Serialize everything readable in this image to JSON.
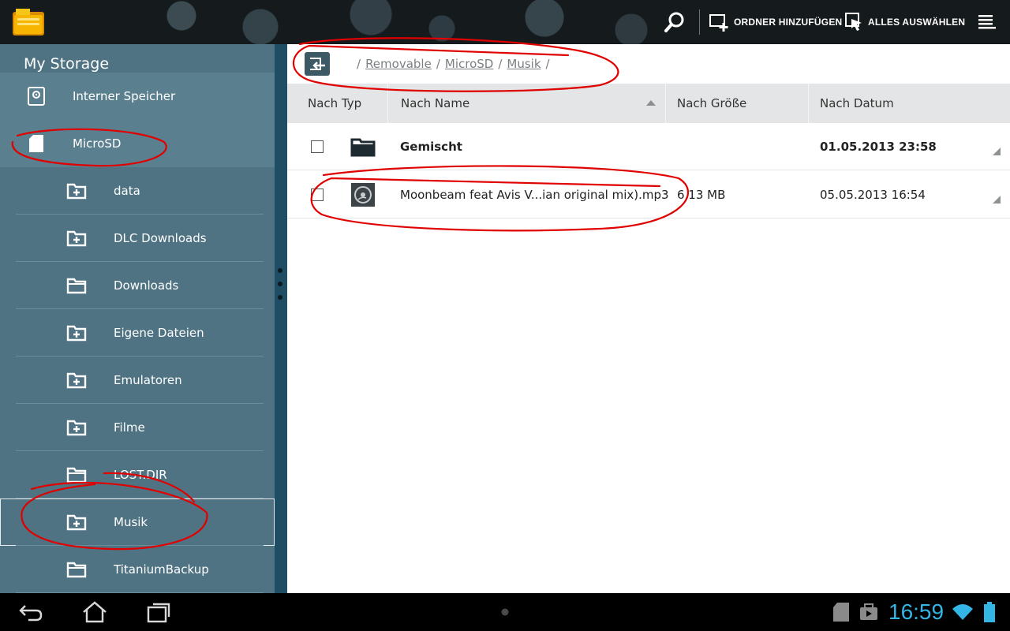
{
  "actionbar": {
    "search_label": "search",
    "add_folder_label": "ORDNER HINZUFÜGEN",
    "select_all_label": "ALLES AUSWÄHLEN"
  },
  "sidebar": {
    "title": "My Storage",
    "storages": [
      {
        "label": "Interner Speicher",
        "icon": "internal-storage-icon"
      },
      {
        "label": "MicroSD",
        "icon": "sdcard-icon"
      }
    ],
    "folders": [
      {
        "label": "data",
        "icon": "folder-plus-icon"
      },
      {
        "label": "DLC Downloads",
        "icon": "folder-plus-icon"
      },
      {
        "label": "Downloads",
        "icon": "folder-icon"
      },
      {
        "label": "Eigene Dateien",
        "icon": "folder-plus-icon"
      },
      {
        "label": "Emulatoren",
        "icon": "folder-plus-icon"
      },
      {
        "label": "Filme",
        "icon": "folder-plus-icon"
      },
      {
        "label": "LOST.DIR",
        "icon": "folder-icon"
      },
      {
        "label": "Musik",
        "icon": "folder-plus-icon",
        "selected": true
      },
      {
        "label": "TitaniumBackup",
        "icon": "folder-icon"
      }
    ]
  },
  "path": {
    "segments": [
      "Removable",
      "MicroSD",
      "Musik"
    ],
    "separator": "/"
  },
  "columns": {
    "type": "Nach Typ",
    "name": "Nach Name",
    "size": "Nach Größe",
    "date": "Nach Datum"
  },
  "files": [
    {
      "name": "Gemischt",
      "size": "",
      "date": "01.05.2013 23:58",
      "icon": "folder-icon",
      "bold": true
    },
    {
      "name": "Moonbeam feat Avis V...ian original mix).mp3",
      "size": "6,13 MB",
      "date": "05.05.2013 16:54",
      "icon": "music-file-icon",
      "bold": false
    }
  ],
  "status": {
    "time": "16:59"
  },
  "colors": {
    "sidebar": "#4f7382",
    "accent": "#33b5e5",
    "annotation": "#e00000"
  }
}
